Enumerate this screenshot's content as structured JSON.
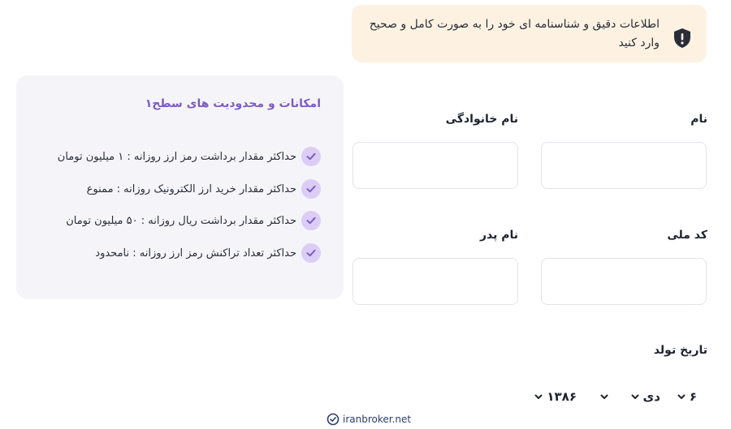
{
  "notice": {
    "icon": "shield-exclamation-icon",
    "message": "اطلاعات دقیق و شناسنامه ای خود را به صورت کامل و صحیح وارد کنید"
  },
  "limits": {
    "title": "امکانات و محدودیت های سطح۱",
    "items": [
      {
        "text": "حداکثر مقدار برداشت رمز ارز روزانه : ۱ میلیون تومان"
      },
      {
        "text": "حداکثر مقدار خرید ارز الکترونیک روزانه : ممنوع"
      },
      {
        "text": "حداکثر مقدار برداشت ریال روزانه : ۵۰ میلیون تومان"
      },
      {
        "text": "حداکثر تعداد تراکنش رمز ارز روزانه : نامحدود"
      }
    ]
  },
  "form": {
    "first_name_label": "نام",
    "last_name_label": "نام خانوادگی",
    "national_code_label": "کد ملی",
    "father_name_label": "نام پدر",
    "birth_date_label": "تاریخ تولد",
    "birth_day": "۶",
    "birth_month": "دی",
    "birth_year": "۱۳۸۶"
  },
  "watermark": {
    "text": "iranbroker.net",
    "icon": "check-badge-icon"
  },
  "colors": {
    "accent": "#7c5cc4",
    "notice_bg": "#fdf2e2",
    "panel_bg": "#f5f5f9",
    "check_bg": "#dccdf6"
  }
}
